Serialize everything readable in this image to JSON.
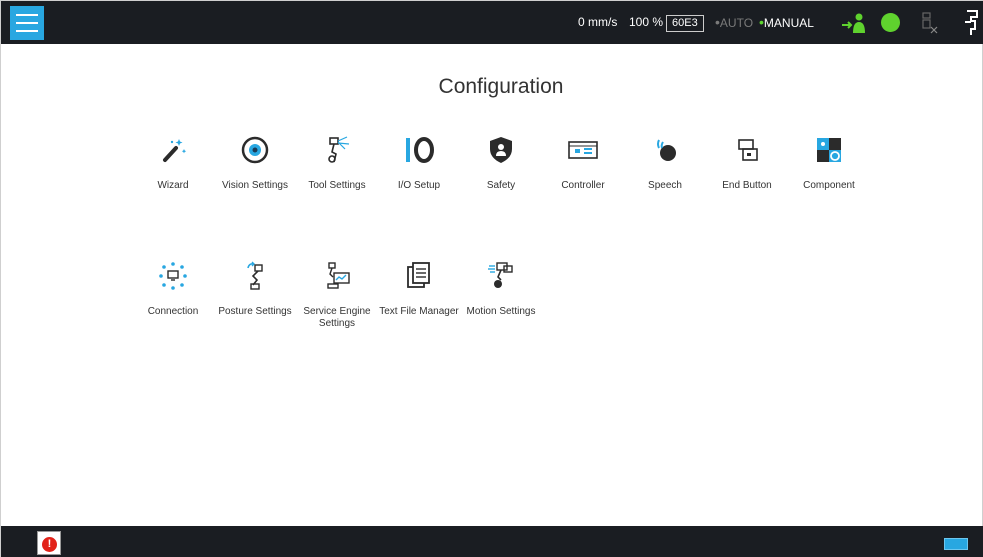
{
  "header": {
    "speed": "0 mm/s",
    "percent": "100 %",
    "model": "60E3",
    "auto_label": "AUTO",
    "manual_label": "MANUAL"
  },
  "main": {
    "title": "Configuration",
    "items": [
      {
        "label": "Wizard",
        "icon": "wizard-wand-icon"
      },
      {
        "label": "Vision Settings",
        "icon": "vision-eye-icon"
      },
      {
        "label": "Tool Settings",
        "icon": "tool-settings-icon"
      },
      {
        "label": "I/O Setup",
        "icon": "io-setup-icon"
      },
      {
        "label": "Safety",
        "icon": "safety-shield-icon"
      },
      {
        "label": "Controller",
        "icon": "controller-icon"
      },
      {
        "label": "Speech",
        "icon": "speech-icon"
      },
      {
        "label": "End Button",
        "icon": "end-button-icon"
      },
      {
        "label": "Component",
        "icon": "component-icon"
      },
      {
        "label": "Connection",
        "icon": "connection-icon"
      },
      {
        "label": "Posture Settings",
        "icon": "posture-settings-icon"
      },
      {
        "label": "Service Engine Settings",
        "icon": "service-engine-icon"
      },
      {
        "label": "Text File Manager",
        "icon": "text-file-icon"
      },
      {
        "label": "Motion Settings",
        "icon": "motion-settings-icon"
      }
    ]
  },
  "colors": {
    "bar_bg": "#1a1d22",
    "accent_blue": "#28a7e1",
    "status_green": "#5fd22e",
    "alert_red": "#e2231a"
  }
}
